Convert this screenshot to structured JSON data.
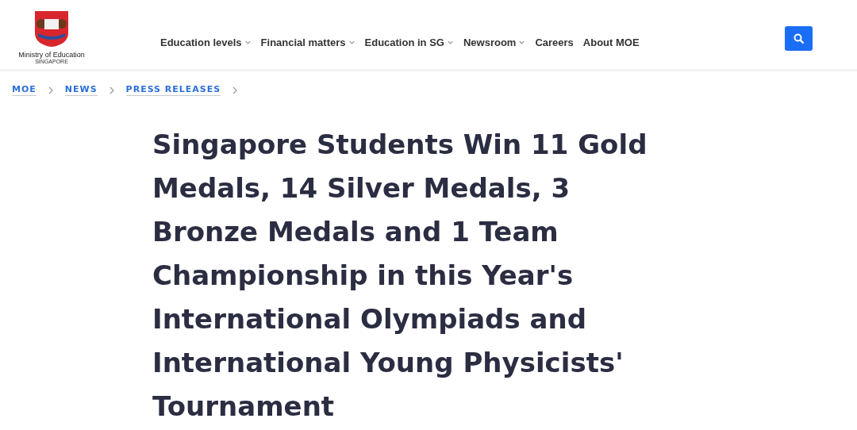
{
  "logo": {
    "name": "Ministry of Education",
    "country": "SINGAPORE"
  },
  "nav": [
    {
      "label": "Education levels",
      "dropdown": true
    },
    {
      "label": "Financial matters",
      "dropdown": true
    },
    {
      "label": "Education in SG",
      "dropdown": true
    },
    {
      "label": "Newsroom",
      "dropdown": true
    },
    {
      "label": "Careers",
      "dropdown": false
    },
    {
      "label": "About MOE",
      "dropdown": false
    }
  ],
  "breadcrumbs": [
    "MOE",
    "NEWS",
    "PRESS RELEASES"
  ],
  "headline": "Singapore Students Win 11 Gold Medals, 14 Silver Medals, 3 Bronze Medals and 1 Team Championship in this Year's International Olympiads and International Young Physicists' Tournament"
}
